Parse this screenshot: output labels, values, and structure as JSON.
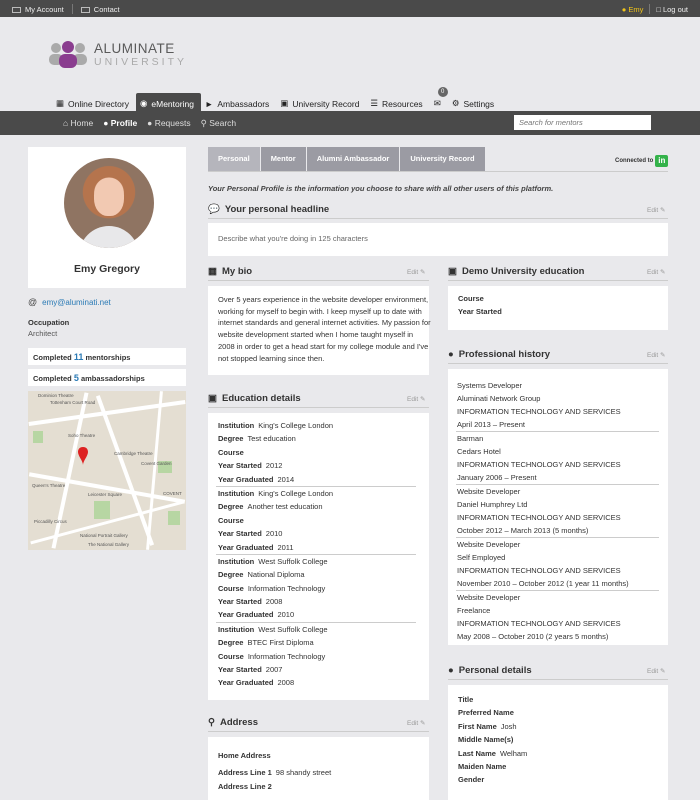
{
  "topbar": {
    "my_account": "My Account",
    "contact": "Contact",
    "user": "Emy",
    "logout": "Log out"
  },
  "logo": {
    "line1": "ALUMINATE",
    "line2": "UNIVERSITY"
  },
  "nav": {
    "tabs": [
      "Online Directory",
      "eMentoring",
      "Ambassadors",
      "University Record",
      "Resources",
      "Settings"
    ],
    "message_count": "0"
  },
  "subnav": {
    "home": "Home",
    "profile": "Profile",
    "requests": "Requests",
    "search": "Search",
    "search_placeholder": "Search for mentors"
  },
  "profile": {
    "name": "Emy Gregory",
    "email": "emy@aluminati.net",
    "occupation_label": "Occupation",
    "occupation": "Architect",
    "mentorships_pre": "Completed",
    "mentorships_count": "11",
    "mentorships_post": "mentorships",
    "ambassadorships_pre": "Completed",
    "ambassadorships_count": "5",
    "ambassadorships_post": "ambassadorships"
  },
  "map": {
    "labels": [
      "Dominion Theatre",
      "Tottenham Court Road",
      "Soho Theatre",
      "Cambridge Theatre",
      "Covent Garden",
      "Queen's Theatre",
      "Leicester Square",
      "Piccadilly Circus",
      "National Portrait Gallery",
      "The National Gallery",
      "COVENT"
    ]
  },
  "ptabs": [
    "Personal",
    "Mentor",
    "Alumni Ambassador",
    "University Record"
  ],
  "connected": "Connected to",
  "linkedin": "in",
  "intro": "Your Personal Profile is the information you choose to share with all other users of this platform.",
  "edit_label": "Edit",
  "headline": {
    "title": "Your personal headline",
    "placeholder": "Describe what you're doing in 125 characters"
  },
  "bio": {
    "title": "My bio",
    "text": "Over 5 years experience in the website developer environment, working for myself to begin with. I keep myself up to date with internet standards and general internet activities. My passion for website development started when I home taught myself in 2008 in order to get a head start for my college module and I've not stopped learning since then."
  },
  "education": {
    "title": "Education details",
    "labels": {
      "institution": "Institution",
      "degree": "Degree",
      "course": "Course",
      "start": "Year Started",
      "end": "Year Graduated"
    },
    "entries": [
      {
        "institution": "King's College London",
        "degree": "Test education",
        "course": "",
        "start": "2012",
        "end": "2014"
      },
      {
        "institution": "King's College London",
        "degree": "Another test education",
        "course": "",
        "start": "2010",
        "end": "2011"
      },
      {
        "institution": "West Suffolk College",
        "degree": "National Diploma",
        "course": "Information Technology",
        "start": "2008",
        "end": "2010"
      },
      {
        "institution": "West Suffolk College",
        "degree": "BTEC First Diploma",
        "course": "Information Technology",
        "start": "2007",
        "end": "2008"
      }
    ]
  },
  "address": {
    "title": "Address",
    "home": "Home Address",
    "line1_label": "Address Line 1",
    "line1": "98 shandy street",
    "line2_label": "Address Line 2"
  },
  "demo_edu": {
    "title": "Demo University education",
    "course": "Course",
    "start": "Year Started"
  },
  "history": {
    "title": "Professional history",
    "entries": [
      {
        "role": "Systems Developer",
        "company": "Aluminati Network Group",
        "industry": "INFORMATION TECHNOLOGY AND SERVICES",
        "period": "April 2013 – Present"
      },
      {
        "role": "Barman",
        "company": "Cedars Hotel",
        "industry": "INFORMATION TECHNOLOGY AND SERVICES",
        "period": "January 2006 – Present"
      },
      {
        "role": "Website Developer",
        "company": "Daniel Humphrey Ltd",
        "industry": "INFORMATION TECHNOLOGY AND SERVICES",
        "period": "October 2012 – March 2013 (5 months)"
      },
      {
        "role": "Website Developer",
        "company": "Self Employed",
        "industry": "INFORMATION TECHNOLOGY AND SERVICES",
        "period": "November 2010 – October 2012 (1 year 11 months)"
      },
      {
        "role": "Website Developer",
        "company": "Freelance",
        "industry": "INFORMATION TECHNOLOGY AND SERVICES",
        "period": "May 2008 – October 2010 (2 years 5 months)"
      }
    ]
  },
  "personal": {
    "title": "Personal details",
    "labels": [
      "Title",
      "Preferred Name",
      "First Name",
      "Middle Name(s)",
      "Last Name",
      "Maiden Name",
      "Gender"
    ],
    "values": [
      "",
      "",
      "Josh",
      "",
      "Welham",
      "",
      ""
    ]
  }
}
